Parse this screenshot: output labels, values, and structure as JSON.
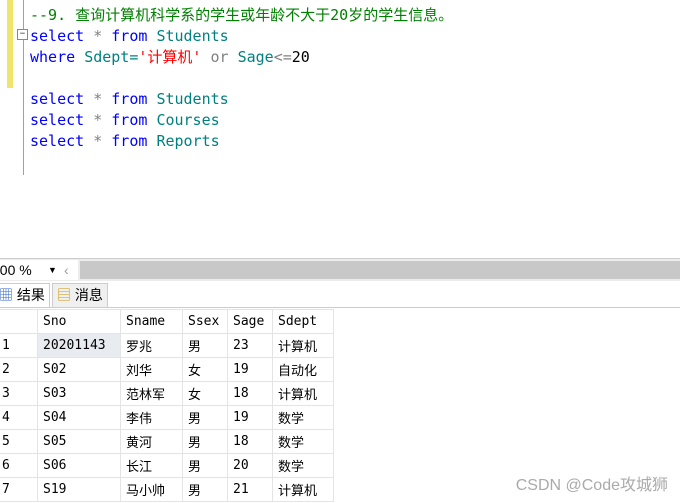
{
  "editor": {
    "comment": "--9. 查询计算机科学系的学生或年龄不大于20岁的学生信息。",
    "l2": {
      "kw1": "select",
      "star": "*",
      "kw2": "from",
      "tbl": "Students"
    },
    "l3": {
      "kw": "where",
      "col": "Sdept=",
      "str": "'计算机'",
      "or": "or",
      "col2": "Sage",
      "op": "<=",
      "num": "20"
    },
    "queries": [
      {
        "kw1": "select",
        "star": "*",
        "kw2": "from",
        "tbl": "Students"
      },
      {
        "kw1": "select",
        "star": "*",
        "kw2": "from",
        "tbl": "Courses"
      },
      {
        "kw1": "select",
        "star": "*",
        "kw2": "from",
        "tbl": "Reports"
      }
    ]
  },
  "status": {
    "zoom": "100 %"
  },
  "tabs": [
    {
      "label": "结果"
    },
    {
      "label": "消息"
    }
  ],
  "grid": {
    "columns": [
      "",
      "Sno",
      "Sname",
      "Ssex",
      "Sage",
      "Sdept"
    ],
    "rows": [
      [
        "1",
        "20201143",
        "罗兆",
        "男",
        "23",
        "计算机"
      ],
      [
        "2",
        "S02",
        "刘华",
        "女",
        "19",
        "自动化"
      ],
      [
        "3",
        "S03",
        "范林军",
        "女",
        "18",
        "计算机"
      ],
      [
        "4",
        "S04",
        "李伟",
        "男",
        "19",
        "数学"
      ],
      [
        "5",
        "S05",
        "黄河",
        "男",
        "18",
        "数学"
      ],
      [
        "6",
        "S06",
        "长江",
        "男",
        "20",
        "数学"
      ],
      [
        "7",
        "S19",
        "马小帅",
        "男",
        "21",
        "计算机"
      ]
    ]
  },
  "watermark": "CSDN @Code攻城狮"
}
